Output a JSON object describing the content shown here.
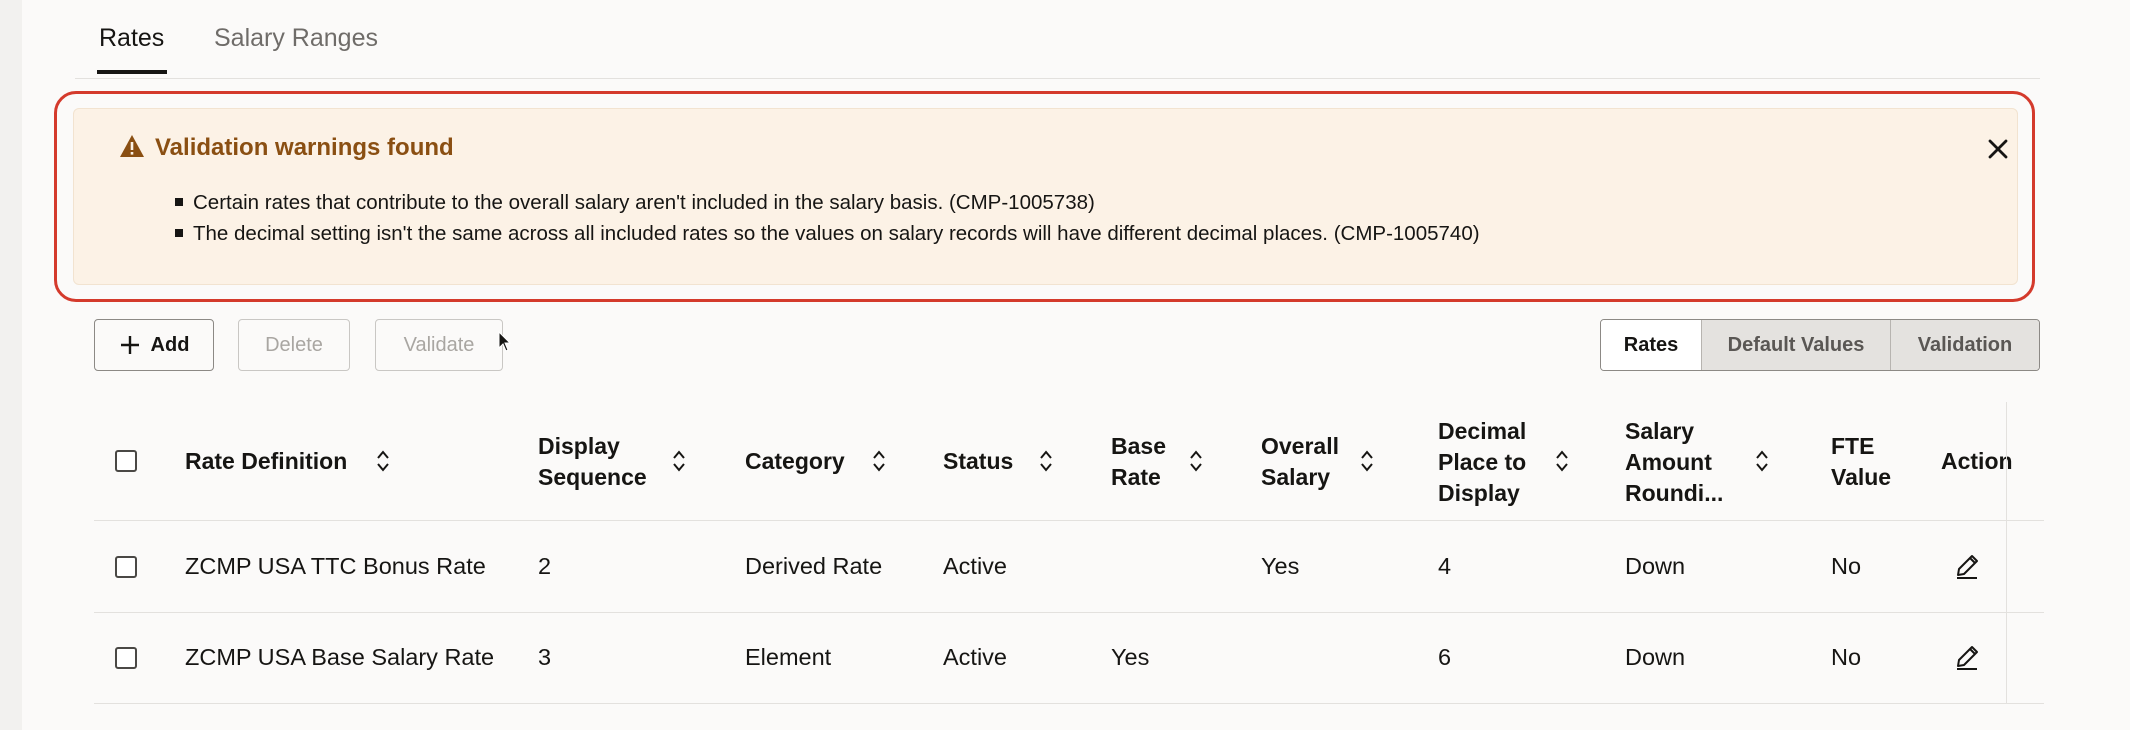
{
  "tabs": [
    {
      "label": "Rates",
      "active": true
    },
    {
      "label": "Salary Ranges",
      "active": false
    }
  ],
  "warning": {
    "title": "Validation warnings found",
    "messages": [
      "Certain rates that contribute to the overall salary aren't included in the salary basis. (CMP-1005738)",
      "The decimal setting isn't the same across all included rates so the values on salary records will have different decimal places. (CMP-1005740)"
    ],
    "accent_color": "#d43a2c",
    "title_color": "#8a4f12"
  },
  "toolbar": {
    "add_label": "Add",
    "delete_label": "Delete",
    "validate_label": "Validate"
  },
  "view_switch": {
    "items": [
      "Rates",
      "Default Values",
      "Validation"
    ],
    "selected": "Rates"
  },
  "table": {
    "columns": [
      "Rate Definition",
      "Display Sequence",
      "Category",
      "Status",
      "Base Rate",
      "Overall Salary",
      "Decimal Place to Display",
      "Salary Amount Roundi...",
      "FTE Value",
      "Action"
    ],
    "column_lines": {
      "display_sequence": [
        "Display",
        "Sequence"
      ],
      "base_rate": [
        "Base",
        "Rate"
      ],
      "overall_salary": [
        "Overall",
        "Salary"
      ],
      "decimal_place": [
        "Decimal",
        "Place to",
        "Display"
      ],
      "salary_amount": [
        "Salary",
        "Amount",
        "Roundi..."
      ],
      "fte_value": [
        "FTE",
        "Value"
      ]
    },
    "rows": [
      {
        "rate_definition": "ZCMP USA TTC Bonus Rate",
        "display_sequence": "2",
        "category": "Derived Rate",
        "status": "Active",
        "base_rate": "",
        "overall_salary": "Yes",
        "decimal_place": "4",
        "salary_amount_rounding": "Down",
        "fte_value": "No"
      },
      {
        "rate_definition": "ZCMP USA Base Salary Rate",
        "display_sequence": "3",
        "category": "Element",
        "status": "Active",
        "base_rate": "Yes",
        "overall_salary": "",
        "decimal_place": "6",
        "salary_amount_rounding": "Down",
        "fte_value": "No"
      }
    ]
  }
}
